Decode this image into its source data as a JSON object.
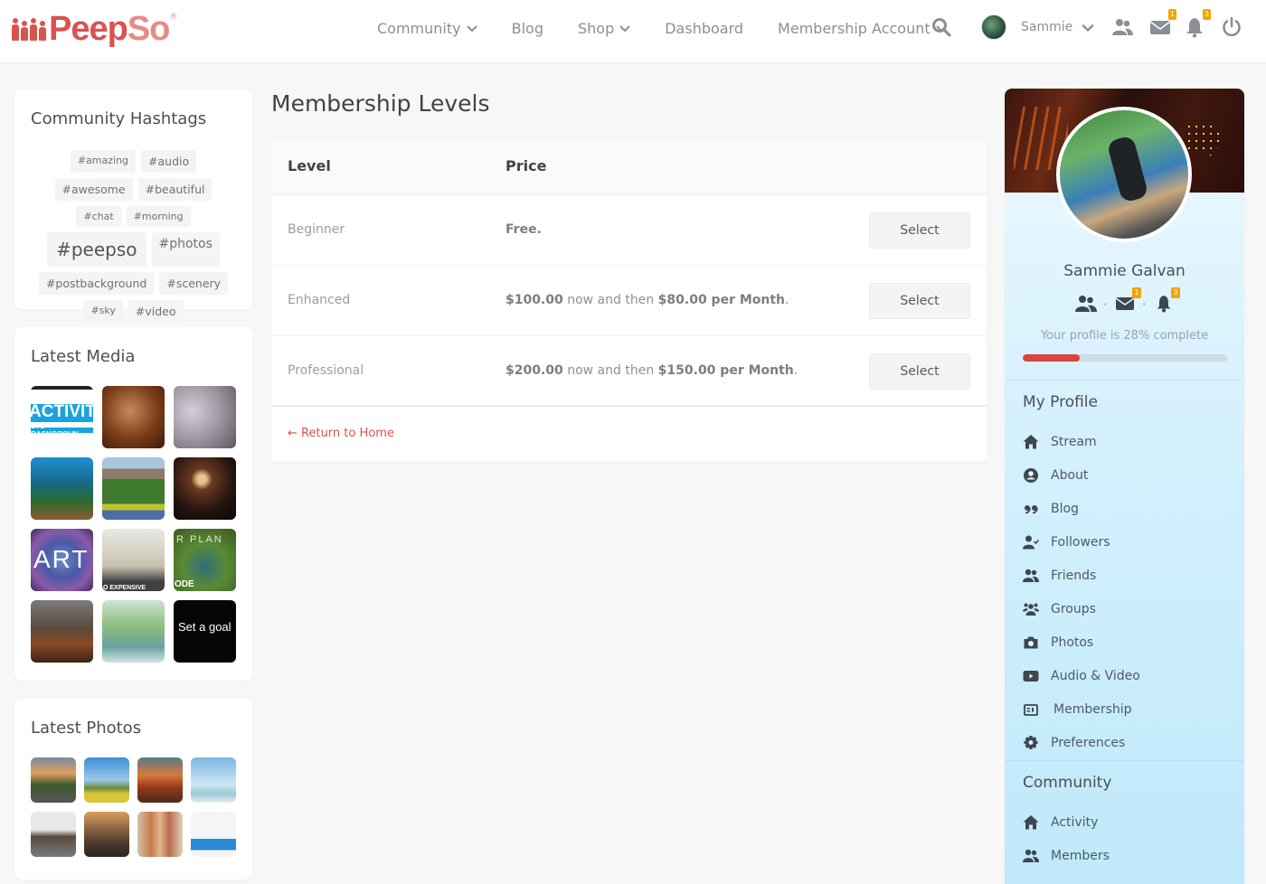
{
  "header": {
    "logo_text_main": "Peep",
    "logo_text_accent": "So",
    "logo_reg": "®",
    "nav": [
      {
        "label": "Community",
        "has_dropdown": true
      },
      {
        "label": "Blog",
        "has_dropdown": false
      },
      {
        "label": "Shop",
        "has_dropdown": true
      },
      {
        "label": "Dashboard",
        "has_dropdown": false
      },
      {
        "label": "Membership Account",
        "has_dropdown": true
      }
    ],
    "user_name": "Sammie",
    "messages_badge": "1",
    "notifications_badge": "3",
    "icons": [
      "search-icon",
      "friends-icon",
      "envelope-icon",
      "bell-icon",
      "power-icon"
    ]
  },
  "hashtags": {
    "title": "Community Hashtags",
    "tags": [
      {
        "label": "#amazing",
        "size": "xs"
      },
      {
        "label": "#audio",
        "size": "s"
      },
      {
        "label": "#awesome",
        "size": "s"
      },
      {
        "label": "#beautiful",
        "size": "s"
      },
      {
        "label": "#chat",
        "size": "xs"
      },
      {
        "label": "#morning",
        "size": "xs"
      },
      {
        "label": "#peepso",
        "size": "xl"
      },
      {
        "label": "#photos",
        "size": "m"
      },
      {
        "label": "#postbackground",
        "size": "s"
      },
      {
        "label": "#scenery",
        "size": "s"
      },
      {
        "label": "#sky",
        "size": "xs"
      },
      {
        "label": "#video",
        "size": "s"
      }
    ]
  },
  "latest_media": {
    "title": "Latest Media",
    "items": [
      {
        "caption": "ACTIVITY",
        "sub": "STS BACKGROUN"
      },
      {
        "caption": ""
      },
      {
        "caption": ""
      },
      {
        "caption": ""
      },
      {
        "caption": ""
      },
      {
        "caption": ""
      },
      {
        "caption": "ART"
      },
      {
        "caption": "O EXPENSIVE"
      },
      {
        "caption": "R PLAN",
        "sub": "ODE"
      },
      {
        "caption": ""
      },
      {
        "caption": ""
      },
      {
        "caption": "Set a goal"
      }
    ]
  },
  "latest_photos": {
    "title": "Latest Photos",
    "count": 8
  },
  "main": {
    "page_title": "Membership Levels",
    "columns": {
      "level": "Level",
      "price": "Price"
    },
    "levels": [
      {
        "name": "Beginner",
        "price_initial": "Free.",
        "price_connector": "",
        "price_recurring": "",
        "button": "Select"
      },
      {
        "name": "Enhanced",
        "price_initial": "$100.00",
        "price_connector": " now and then ",
        "price_recurring": "$80.00 per Month",
        "button": "Select"
      },
      {
        "name": "Professional",
        "price_initial": "$200.00",
        "price_connector": " now and then ",
        "price_recurring": "$150.00 per Month",
        "button": "Select"
      }
    ],
    "return_link": "← Return to Home"
  },
  "profile": {
    "name": "Sammie Galvan",
    "messages_badge": "1",
    "notifications_badge": "3",
    "completion_text": "Your profile is 28% complete",
    "completion_percent": 28,
    "my_profile_title": "My Profile",
    "my_profile_items": [
      {
        "label": "Stream",
        "icon": "home-icon"
      },
      {
        "label": "About",
        "icon": "user-circle-icon"
      },
      {
        "label": "Blog",
        "icon": "quote-icon"
      },
      {
        "label": "Followers",
        "icon": "user-check-icon"
      },
      {
        "label": "Friends",
        "icon": "users-icon"
      },
      {
        "label": "Groups",
        "icon": "groups-icon"
      },
      {
        "label": "Photos",
        "icon": "camera-icon"
      },
      {
        "label": "Audio & Video",
        "icon": "video-icon"
      },
      {
        "label": "Membership",
        "icon": "id-card-icon"
      },
      {
        "label": "Preferences",
        "icon": "gear-icon"
      }
    ],
    "community_title": "Community",
    "community_items": [
      {
        "label": "Activity",
        "icon": "home-icon"
      },
      {
        "label": "Members",
        "icon": "users-icon"
      }
    ]
  },
  "colors": {
    "brand": "#d9534f",
    "badge": "#f0a500",
    "progress_track": "#ccdde4",
    "sidebar_text": "#4f5a66"
  }
}
